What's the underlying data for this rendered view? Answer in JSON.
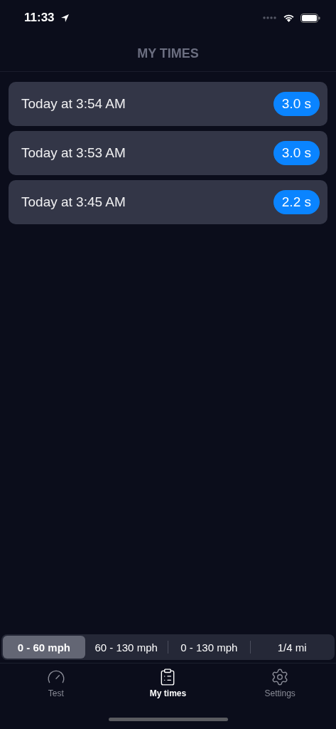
{
  "status_bar": {
    "time": "11:33"
  },
  "header": {
    "title": "MY TIMES"
  },
  "times": [
    {
      "label": "Today at 3:54 AM",
      "value": "3.0 s"
    },
    {
      "label": "Today at 3:53 AM",
      "value": "3.0 s"
    },
    {
      "label": "Today at 3:45 AM",
      "value": "2.2 s"
    }
  ],
  "segments": [
    {
      "label": "0 - 60 mph",
      "selected": true
    },
    {
      "label": "60 - 130 mph",
      "selected": false
    },
    {
      "label": "0 - 130 mph",
      "selected": false
    },
    {
      "label": "1/4 mi",
      "selected": false
    }
  ],
  "tab_bar": [
    {
      "kind": "test",
      "label": "Test",
      "selected": false
    },
    {
      "kind": "times",
      "label": "My times",
      "selected": true
    },
    {
      "kind": "settings",
      "label": "Settings",
      "selected": false
    }
  ]
}
